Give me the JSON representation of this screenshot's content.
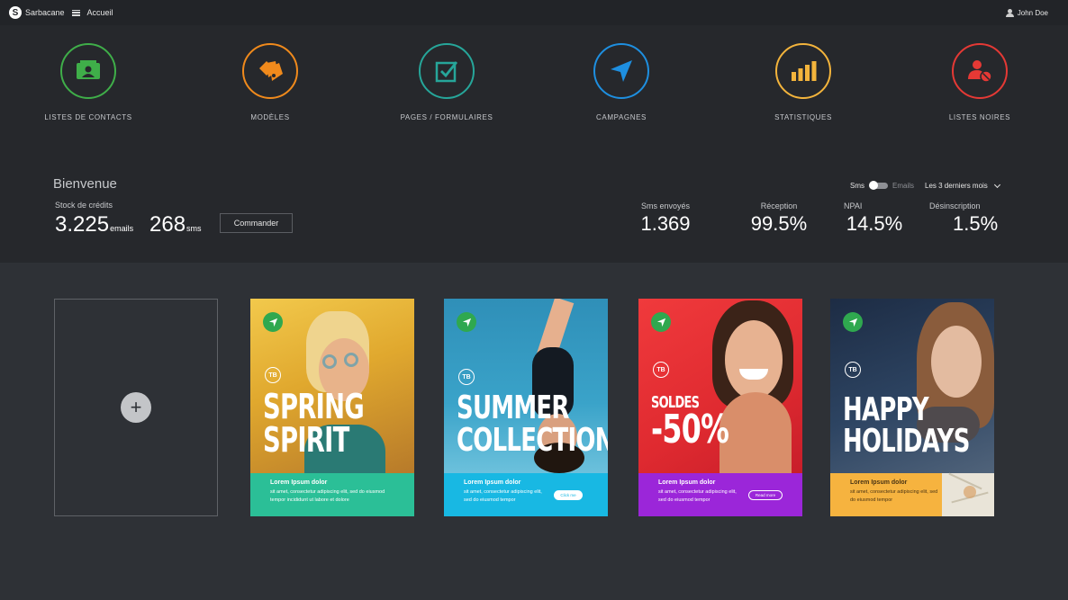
{
  "topbar": {
    "brand": "Sarbacane",
    "home": "Accueil",
    "user": "John Doe"
  },
  "modules": [
    {
      "label": "LISTES DE CONTACTS",
      "icon": "contact-card-icon",
      "color": "#3fae49"
    },
    {
      "label": "MODÈLES",
      "icon": "color-swatch-icon",
      "color": "#f08a1c"
    },
    {
      "label": "PAGES / FORMULAIRES",
      "icon": "checkbox-icon",
      "color": "#26a69a"
    },
    {
      "label": "CAMPAGNES",
      "icon": "send-icon",
      "color": "#1e8fe0"
    },
    {
      "label": "STATISTIQUES",
      "icon": "bar-chart-icon",
      "color": "#f3b43c"
    },
    {
      "label": "LISTES NOIRES",
      "icon": "user-blocked-icon",
      "color": "#e53935"
    }
  ],
  "welcome": {
    "title": "Bienvenue",
    "stock_label": "Stock de crédits",
    "emails_value": "3.225",
    "emails_unit": "emails",
    "sms_value": "268",
    "sms_unit": "sms",
    "order_button": "Commander",
    "toggle_sms": "Sms",
    "toggle_emails": "Emails",
    "period": "Les 3 derniers mois"
  },
  "stats": [
    {
      "label": "Sms envoyés",
      "value": "1.369"
    },
    {
      "label": "Réception",
      "value": "99.5%"
    },
    {
      "label": "NPAI",
      "value": "14.5%"
    },
    {
      "label": "Désinscription",
      "value": "1.5%"
    }
  ],
  "templates": [
    {
      "line1": "SPRING",
      "line2": "SPIRIT",
      "footer_color": "#2bbf97",
      "photo_color": "#e8b52c",
      "footer_title": "Lorem Ipsum dolor",
      "footer_body": "sit amet, consectetur adipiscing elit, sed do eiusmod tempor incididunt ut labore et dolore",
      "cta": ""
    },
    {
      "line1": "SUMMER",
      "line2": "COLLECTION",
      "footer_color": "#18b8e3",
      "photo_color": "#2e93ba",
      "footer_title": "Lorem Ipsum dolor",
      "footer_body": "sit amet, consectetur adipiscing elit, sed do eiusmod tempor",
      "cta": "Click me"
    },
    {
      "line1": "SOLDES",
      "line2": "-50%",
      "footer_color": "#9b26d9",
      "photo_color": "#e02a34",
      "footer_title": "Lorem Ipsum dolor",
      "footer_body": "sit amet, consectetur adipiscing elit, sed do eiusmod tempor",
      "cta": "Read more"
    },
    {
      "line1": "HAPPY",
      "line2": "HOLIDAYS",
      "footer_color": "#f6b33f",
      "photo_color": "#2a3f5c",
      "footer_title": "Lorem Ipsum dolor",
      "footer_body": "sit amet, consectetur adipiscing elit, sed do eiusmod tempor",
      "cta": ""
    }
  ],
  "template_badge": "TB"
}
